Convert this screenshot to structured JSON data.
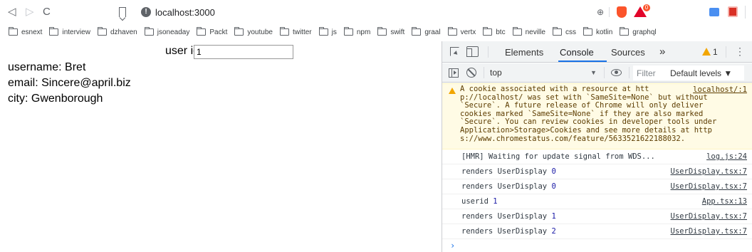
{
  "toolbar": {
    "back_icon": "back-arrow-icon",
    "forward_icon": "forward-arrow-icon",
    "reload_icon": "reload-icon",
    "url": "localhost:3000",
    "rewards_count": "0"
  },
  "bookmarks": [
    "esnext",
    "interview",
    "dzhaven",
    "jsoneaday",
    "Packt",
    "youtube",
    "twitter",
    "js",
    "npm",
    "swift",
    "graal",
    "vertx",
    "btc",
    "neville",
    "css",
    "kotlin",
    "graphql"
  ],
  "page": {
    "user_id_label": "user id",
    "user_id_value": "1",
    "username": "username: Bret",
    "email": "email: Sincere@april.biz",
    "city": "city: Gwenborough"
  },
  "devtools": {
    "tabs": [
      "Elements",
      "Console",
      "Sources"
    ],
    "more_tabs": "»",
    "warning_count": "1",
    "context": "top",
    "filter_placeholder": "Filter",
    "levels": "Default levels ▼",
    "warning_message": {
      "lines": [
        "A cookie associated with a resource at htt",
        "p://localhost/ was set with `SameSite=None` but without",
        "`Secure`. A future release of Chrome will only deliver",
        "cookies marked `SameSite=None` if they are also marked",
        "`Secure`. You can review cookies in developer tools under",
        "Application>Storage>Cookies and see more details at http",
        "s://www.chromestatus.com/feature/5633521622188032."
      ],
      "source": "localhost/:1"
    },
    "logs": [
      {
        "text": "[HMR] Waiting for update signal from WDS...",
        "num": "",
        "source": "log.js:24"
      },
      {
        "text": "renders UserDisplay ",
        "num": "0",
        "source": "UserDisplay.tsx:7"
      },
      {
        "text": "renders UserDisplay ",
        "num": "0",
        "source": "UserDisplay.tsx:7"
      },
      {
        "text": "userid ",
        "num": "1",
        "source": "App.tsx:13"
      },
      {
        "text": "renders UserDisplay ",
        "num": "1",
        "source": "UserDisplay.tsx:7"
      },
      {
        "text": "renders UserDisplay ",
        "num": "2",
        "source": "UserDisplay.tsx:7"
      }
    ],
    "prompt": "›"
  }
}
